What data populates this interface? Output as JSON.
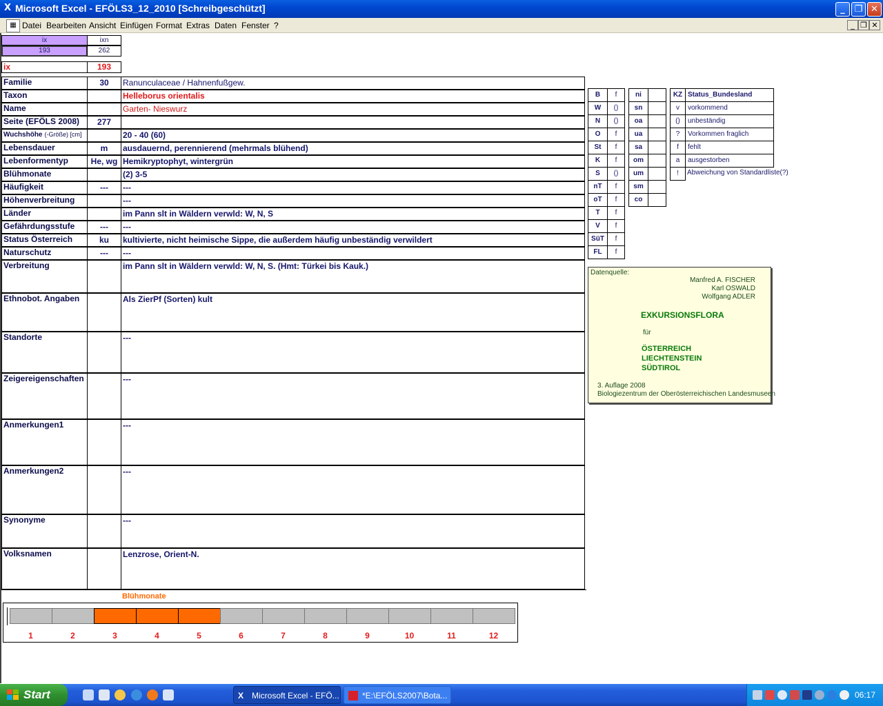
{
  "window": {
    "title": "Microsoft Excel - EFÖLS3_12_2010  [Schreibgeschützt]"
  },
  "menu": [
    "Datei",
    "Bearbeiten",
    "Ansicht",
    "Einfügen",
    "Format",
    "Extras",
    "Daten",
    "Fenster",
    "?"
  ],
  "index_box": {
    "h1": "ix",
    "h2": "ixn",
    "v1": "193",
    "v2": "262",
    "ix_label": "ix",
    "ix_value": "193"
  },
  "fields": [
    {
      "label": "Familie",
      "code": "30",
      "value": "Ranunculaceae  /  Hahnenfußgew."
    },
    {
      "label": "Taxon",
      "code": "",
      "value": "Helleborus orientalis"
    },
    {
      "label": "Name",
      "code": "",
      "value": "Garten- Nieswurz"
    },
    {
      "label": "Seite (EFÖLS 2008)",
      "code": "277",
      "value": ""
    },
    {
      "label": "Wuchshöhe",
      "label_small": "(-Größe) [cm]",
      "code": "",
      "value": " 20 - 40 (60)"
    },
    {
      "label": "Lebensdauer",
      "code": "m",
      "value": "ausdauernd, perennierend (mehrmals blühend)"
    },
    {
      "label": "Lebenformentyp",
      "code": "He, wg",
      "value": "Hemikryptophyt, wintergrün"
    },
    {
      "label": "Blühmonate",
      "code": "",
      "value": "(2) 3-5"
    },
    {
      "label": "Häufigkeit",
      "code": "---",
      "value": " ---"
    },
    {
      "label": "Höhenverbreitung",
      "code": "",
      "value": " ---"
    },
    {
      "label": "Länder",
      "code": "",
      "value": "im Pann slt in Wäldern verwld: W, N, S"
    },
    {
      "label": "Gefährdungsstufe",
      "code": "---",
      "value": "   ---"
    },
    {
      "label": "Status Österreich",
      "code": "ku",
      "value": "kultivierte, nicht heimische Sippe, die außerdem häufig unbeständig verwildert"
    },
    {
      "label": "Naturschutz",
      "code": "---",
      "value": " ---"
    },
    {
      "label": "Verbreitung",
      "code": "",
      "value": "im Pann slt in Wäldern verwld: W, N, S. (Hmt: Türkei bis Kauk.)"
    },
    {
      "label": "Ethnobot. Angaben",
      "code": "",
      "value": "Als ZierPf (Sorten) kult"
    },
    {
      "label": "Standorte",
      "code": "",
      "value": "---"
    },
    {
      "label": "Zeigereigenschaften",
      "code": "",
      "value": "---"
    },
    {
      "label": "Anmerkungen1",
      "code": "",
      "value": "---"
    },
    {
      "label": "Anmerkungen2",
      "code": "",
      "value": "---"
    },
    {
      "label": "Synonyme",
      "code": "",
      "value": "---"
    },
    {
      "label": "Volksnamen",
      "code": "",
      "value": "Lenzrose, Orient-N."
    }
  ],
  "states": [
    {
      "abbr": "B",
      "val": "f"
    },
    {
      "abbr": "W",
      "val": "()"
    },
    {
      "abbr": "N",
      "val": "()"
    },
    {
      "abbr": "O",
      "val": "f"
    },
    {
      "abbr": "St",
      "val": "f"
    },
    {
      "abbr": "K",
      "val": "f"
    },
    {
      "abbr": "S",
      "val": "()"
    },
    {
      "abbr": "nT",
      "val": "f"
    },
    {
      "abbr": "oT",
      "val": "f"
    },
    {
      "abbr": "T",
      "val": "f"
    },
    {
      "abbr": "V",
      "val": "f"
    },
    {
      "abbr": "SüT",
      "val": "f"
    },
    {
      "abbr": "FL",
      "val": "f"
    }
  ],
  "altitude": [
    {
      "abbr": "ni",
      "val": ""
    },
    {
      "abbr": "sn",
      "val": ""
    },
    {
      "abbr": "oa",
      "val": ""
    },
    {
      "abbr": "ua",
      "val": ""
    },
    {
      "abbr": "sa",
      "val": ""
    },
    {
      "abbr": "om",
      "val": ""
    },
    {
      "abbr": "um",
      "val": ""
    },
    {
      "abbr": "sm",
      "val": ""
    },
    {
      "abbr": "co",
      "val": ""
    }
  ],
  "status_legend": {
    "header_kz": "KZ",
    "header_status": "Status_Bundesland",
    "rows": [
      {
        "kz": "v",
        "text": "vorkommend"
      },
      {
        "kz": "()",
        "text": "unbeständig"
      },
      {
        "kz": "?",
        "text": "Vorkommen fraglich"
      },
      {
        "kz": "f",
        "text": "fehlt"
      },
      {
        "kz": "a",
        "text": "ausgestorben"
      },
      {
        "kz": "!",
        "text": "Abweichung von Standardliste(?)"
      }
    ]
  },
  "source": {
    "label": "Datenquelle:",
    "authors": [
      "Manfred A. FISCHER",
      "Karl OSWALD",
      "Wolfgang ADLER"
    ],
    "title": "EXKURSIONSFLORA",
    "fuer": "für",
    "countries": [
      "ÖSTERREICH",
      "LIECHTENSTEIN",
      "SÜDTIROL"
    ],
    "edition": "3. Auflage 2008",
    "publisher": "Biologiezentrum der Oberösterreichischen Landesmuseen"
  },
  "bloom_chart": {
    "title": "Blühmonate",
    "months": [
      "1",
      "2",
      "3",
      "4",
      "5",
      "6",
      "7",
      "8",
      "9",
      "10",
      "11",
      "12"
    ],
    "active": [
      false,
      false,
      true,
      true,
      true,
      false,
      false,
      false,
      false,
      false,
      false,
      false
    ],
    "colors": {
      "active": "#ff6a00",
      "inactive": "#c0c0c0"
    }
  },
  "taskbar": {
    "start": "Start",
    "tasks": [
      "Microsoft Excel - EFÖ...",
      "*E:\\EFÖLS2007\\Bota..."
    ],
    "clock": "06:17"
  },
  "colors": {
    "title_bar": "#0047d0",
    "taxon_red": "#e01818",
    "lilac": "#c9a0ff"
  }
}
